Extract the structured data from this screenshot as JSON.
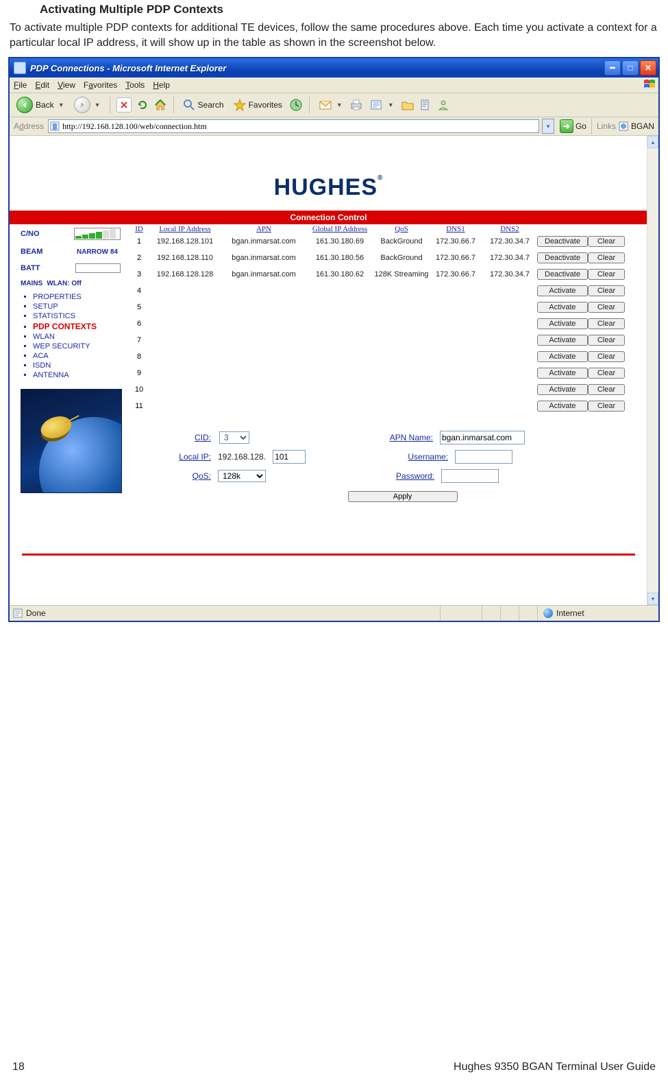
{
  "doc": {
    "heading": "Activating Multiple PDP Contexts",
    "body": "To activate multiple PDP contexts for additional TE devices, follow the same procedures above. Each time you activate a context for a particular local IP address, it will show up in the table as shown in the screenshot below.",
    "page_number": "18",
    "footer": "Hughes 9350 BGAN Terminal User Guide"
  },
  "window": {
    "title": "PDP Connections - Microsoft Internet Explorer"
  },
  "menubar": [
    "File",
    "Edit",
    "View",
    "Favorites",
    "Tools",
    "Help"
  ],
  "toolbar": {
    "back": "Back",
    "search": "Search",
    "favorites": "Favorites"
  },
  "addressbar": {
    "label": "Address",
    "url": "http://192.168.128.100/web/connection.htm",
    "go": "Go",
    "links_label": "Links",
    "links_item": "BGAN"
  },
  "page_content": {
    "banner_title": "Connection Control",
    "status": {
      "cno_label": "C/NO",
      "beam_label": "BEAM",
      "beam_value": "NARROW 84",
      "batt_label": "BATT",
      "mains_label": "MAINS",
      "wlan_label": "WLAN: Off"
    },
    "nav": [
      {
        "label": "PROPERTIES",
        "active": false
      },
      {
        "label": "SETUP",
        "active": false
      },
      {
        "label": "STATISTICS",
        "active": false
      },
      {
        "label": "PDP CONTEXTS",
        "active": true
      },
      {
        "label": "WLAN",
        "active": false
      },
      {
        "label": "WEP SECURITY",
        "active": false
      },
      {
        "label": "ACA",
        "active": false
      },
      {
        "label": "ISDN",
        "active": false
      },
      {
        "label": "ANTENNA",
        "active": false
      }
    ],
    "table": {
      "headers": {
        "id": "ID",
        "local_ip": "Local IP Address",
        "apn": "APN",
        "global_ip": "Global IP Address",
        "qos": "QoS",
        "dns1": "DNS1",
        "dns2": "DNS2"
      },
      "rows": [
        {
          "id": "1",
          "local_ip": "192.168.128.101",
          "apn": "bgan.inmarsat.com",
          "global_ip": "161.30.180.69",
          "qos": "BackGround",
          "dns1": "172.30.66.7",
          "dns2": "172.30.34.7",
          "action": "Deactivate",
          "clear": "Clear"
        },
        {
          "id": "2",
          "local_ip": "192.168.128.110",
          "apn": "bgan.inmarsat.com",
          "global_ip": "161.30.180.56",
          "qos": "BackGround",
          "dns1": "172.30.66.7",
          "dns2": "172.30.34.7",
          "action": "Deactivate",
          "clear": "Clear"
        },
        {
          "id": "3",
          "local_ip": "192.168.128.128",
          "apn": "bgan.inmarsat.com",
          "global_ip": "161.30.180.62",
          "qos": "128K Streaming",
          "dns1": "172.30.66.7",
          "dns2": "172.30.34.7",
          "action": "Deactivate",
          "clear": "Clear"
        },
        {
          "id": "4",
          "local_ip": "",
          "apn": "",
          "global_ip": "",
          "qos": "",
          "dns1": "",
          "dns2": "",
          "action": "Activate",
          "clear": "Clear"
        },
        {
          "id": "5",
          "local_ip": "",
          "apn": "",
          "global_ip": "",
          "qos": "",
          "dns1": "",
          "dns2": "",
          "action": "Activate",
          "clear": "Clear"
        },
        {
          "id": "6",
          "local_ip": "",
          "apn": "",
          "global_ip": "",
          "qos": "",
          "dns1": "",
          "dns2": "",
          "action": "Activate",
          "clear": "Clear"
        },
        {
          "id": "7",
          "local_ip": "",
          "apn": "",
          "global_ip": "",
          "qos": "",
          "dns1": "",
          "dns2": "",
          "action": "Activate",
          "clear": "Clear"
        },
        {
          "id": "8",
          "local_ip": "",
          "apn": "",
          "global_ip": "",
          "qos": "",
          "dns1": "",
          "dns2": "",
          "action": "Activate",
          "clear": "Clear"
        },
        {
          "id": "9",
          "local_ip": "",
          "apn": "",
          "global_ip": "",
          "qos": "",
          "dns1": "",
          "dns2": "",
          "action": "Activate",
          "clear": "Clear"
        },
        {
          "id": "10",
          "local_ip": "",
          "apn": "",
          "global_ip": "",
          "qos": "",
          "dns1": "",
          "dns2": "",
          "action": "Activate",
          "clear": "Clear"
        },
        {
          "id": "11",
          "local_ip": "",
          "apn": "",
          "global_ip": "",
          "qos": "",
          "dns1": "",
          "dns2": "",
          "action": "Activate",
          "clear": "Clear"
        }
      ]
    },
    "form": {
      "cid_label": "CID:",
      "cid_value": "3",
      "local_ip_label": "Local IP:",
      "local_ip_prefix": "192.168.128.",
      "local_ip_value": "101",
      "qos_label": "QoS:",
      "qos_value": "128k",
      "apn_label": "APN Name:",
      "apn_value": "bgan.inmarsat.com",
      "user_label": "Username:",
      "user_value": "",
      "pass_label": "Password:",
      "pass_value": "",
      "apply": "Apply"
    },
    "logo_text": "HUGHES"
  },
  "statusbar": {
    "text": "Done",
    "zone": "Internet"
  }
}
